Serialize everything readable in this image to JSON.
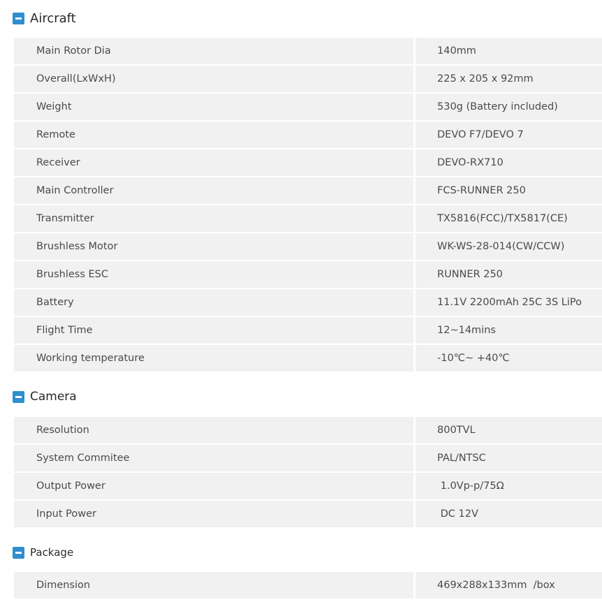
{
  "sections": [
    {
      "title": "Aircraft",
      "rows": [
        {
          "label": "Main Rotor Dia",
          "value": "140mm"
        },
        {
          "label": "Overall(LxWxH)",
          "value": "225 x 205 x 92mm"
        },
        {
          "label": "Weight",
          "value": "530g (Battery included)"
        },
        {
          "label": "Remote",
          "value": "DEVO F7/DEVO 7"
        },
        {
          "label": "Receiver",
          "value": "DEVO-RX710"
        },
        {
          "label": "Main Controller",
          "value": "FCS-RUNNER 250"
        },
        {
          "label": "Transmitter",
          "value": "TX5816(FCC)/TX5817(CE)"
        },
        {
          "label": "Brushless Motor",
          "value": "WK-WS-28-014(CW/CCW)"
        },
        {
          "label": "Brushless ESC",
          "value": "RUNNER 250"
        },
        {
          "label": "Battery",
          "value": "11.1V 2200mAh 25C 3S LiPo"
        },
        {
          "label": "Flight Time",
          "value": "12~14mins"
        },
        {
          "label": "Working temperature",
          "value": "-10℃~ +40℃"
        }
      ]
    },
    {
      "title": "Camera",
      "rows": [
        {
          "label": "Resolution",
          "value": "800TVL"
        },
        {
          "label": "System Commitee",
          "value": "PAL/NTSC"
        },
        {
          "label": "Output Power",
          "value": " 1.0Vp-p/75Ω"
        },
        {
          "label": "Input Power",
          "value": " DC 12V"
        }
      ]
    },
    {
      "title": "Package",
      "rows": [
        {
          "label": "Dimension",
          "value": "469x288x133mm  /box"
        }
      ]
    }
  ]
}
